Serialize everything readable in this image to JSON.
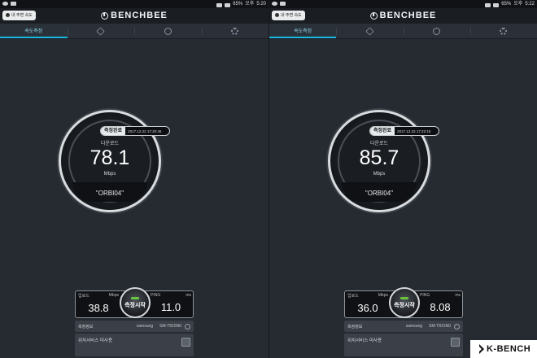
{
  "status_bar": {
    "battery": "65%",
    "time_label": "오후",
    "times": [
      "5:20",
      "5:22"
    ]
  },
  "header": {
    "back_button_label": "내 주변 속도",
    "brand": "BENCHBEE"
  },
  "tabs": {
    "speed_test_label": "속도측정"
  },
  "gauge": {
    "status_label": "측정완료",
    "metric_label": "다운로드",
    "unit": "Mbps"
  },
  "panel": {
    "upload_label": "업로드",
    "upload_unit": "Mbps",
    "ping_label": "PING",
    "ping_unit": "ms",
    "start_button_label": "측정시작",
    "info_label": "측정정보",
    "device_brand": "samsung",
    "device_model": "SM-T815N0",
    "location_label": "위치서비스 미사용"
  },
  "results": [
    {
      "timestamp": "2017.12.22 17:20:46",
      "download": "78.1",
      "ssid": "\"ORBI04\"",
      "upload": "38.8",
      "ping": "11.0"
    },
    {
      "timestamp": "2017.12.22 17:22:15",
      "download": "85.7",
      "ssid": "\"ORBI04\"",
      "upload": "36.0",
      "ping": "8.08"
    }
  ],
  "watermark": {
    "text": "K-BENCH"
  },
  "colors": {
    "accent": "#19b8e2",
    "background": "#262a31",
    "wifi_badge": "#a11c1c",
    "start_indicator": "#6ac23e"
  }
}
